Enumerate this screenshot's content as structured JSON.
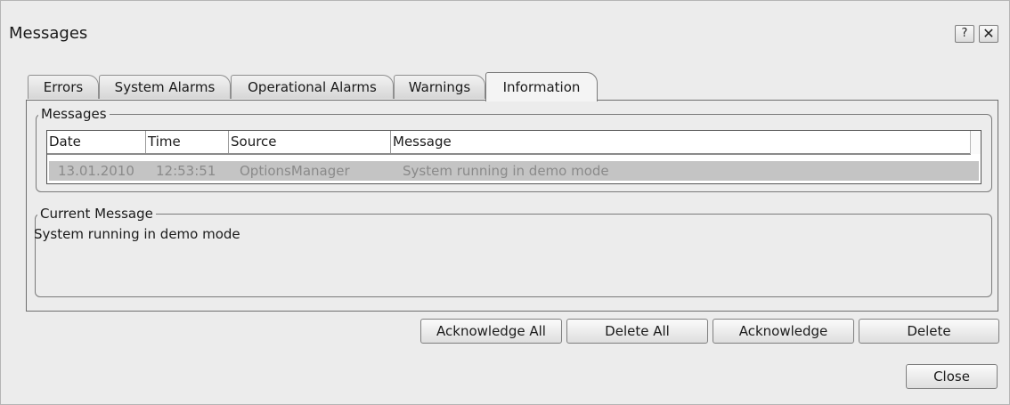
{
  "window": {
    "title": "Messages",
    "help_label": "?",
    "close_label": "✕"
  },
  "tabs": [
    {
      "label": "Errors",
      "active": false
    },
    {
      "label": "System Alarms",
      "active": false
    },
    {
      "label": "Operational Alarms",
      "active": false
    },
    {
      "label": "Warnings",
      "active": false
    },
    {
      "label": "Information",
      "active": true
    }
  ],
  "messages_group": {
    "legend": "Messages",
    "columns": [
      "Date",
      "Time",
      "Source",
      "Message"
    ],
    "rows": [
      {
        "date": "13.01.2010",
        "time": "12:53:51",
        "source": "OptionsManager",
        "message": "System running in demo mode"
      }
    ]
  },
  "current_group": {
    "legend": "Current Message",
    "text": "System running in demo mode"
  },
  "buttons": {
    "acknowledge_all": "Acknowledge All",
    "delete_all": "Delete All",
    "acknowledge": "Acknowledge",
    "delete": "Delete",
    "close": "Close"
  },
  "colors": {
    "background": "#ececec",
    "selected_row": "#c4c4c4",
    "row_text": "#8a8a8a"
  }
}
